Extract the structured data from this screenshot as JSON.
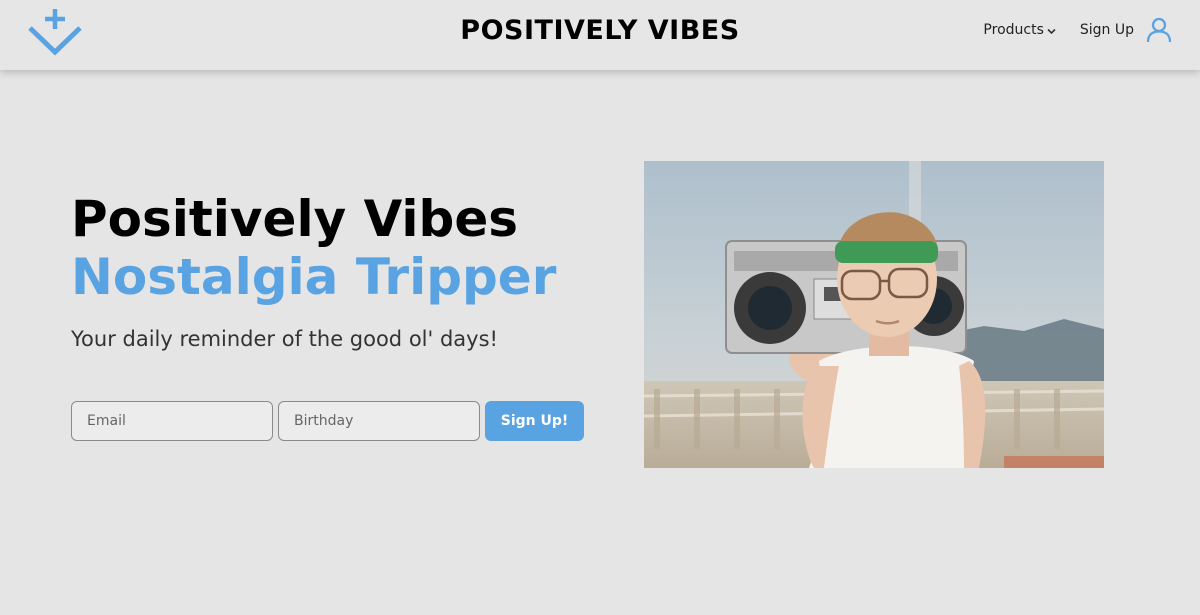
{
  "nav": {
    "brand": "POSITIVELY VIBES",
    "logo_icon": "plus-chevron-down-logo",
    "products_label": "Products",
    "products_icon": "chevron-down-icon",
    "signup_label": "Sign Up",
    "user_icon": "user-icon"
  },
  "hero": {
    "title_line1": "Positively Vibes",
    "title_line2": "Nostalgia Tripper",
    "tagline": "Your daily reminder of the good ol' days!"
  },
  "form": {
    "email_placeholder": "Email",
    "birthday_placeholder": "Birthday",
    "submit_label": "Sign Up!"
  },
  "image": {
    "subject": "boy-with-boombox-photo"
  },
  "colors": {
    "accent": "#5aa3e2",
    "background": "#e5e5e5",
    "text": "#000000"
  }
}
